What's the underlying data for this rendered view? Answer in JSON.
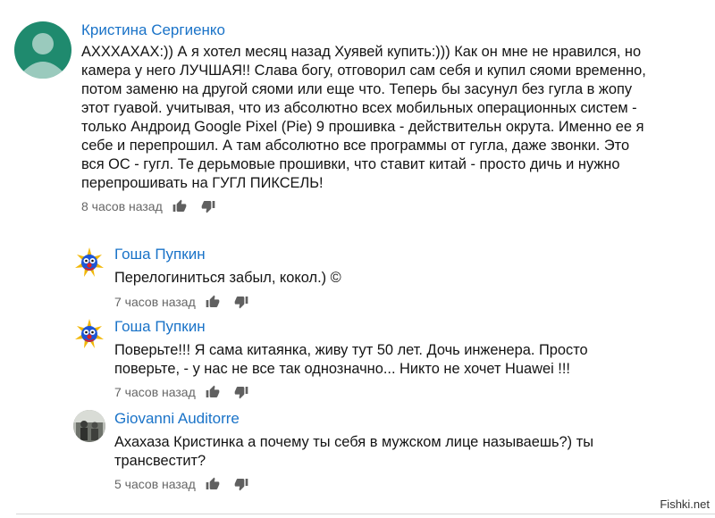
{
  "comments": [
    {
      "author": "Кристина Сергиенко",
      "lines": [
        "АХХХАХАХ:)) А я хотел месяц назад Хуявей купить:))) Как он мне не нравился, но",
        "камера у него ЛУЧШАЯ!! Слава богу, отговорил сам себя и купил сяоми временно,",
        "потом заменю на другой сяоми или еще что. Теперь бы засунул без гугла в жопу",
        "этот гуавой. учитывая, что из абсолютно всех мобильных операционных систем -",
        "только Андроид Google Pixel (Pie) 9 прошивка - действительн окрута. Именно ее я",
        "себе и перепрошил. А там абсолютно все программы от гугла, даже звонки. Это",
        "вся ОС - гугл. Те дерьмовые прошивки, что ставит китай - просто дичь и нужно",
        "перепрошивать на ГУГЛ ПИКСЕЛЬ!"
      ],
      "time": "8 часов назад",
      "avatar_color": "#1f8a6e"
    },
    {
      "author": "Гоша Пупкин",
      "lines": [
        "Перелогиниться забыл, кокол.) ©"
      ],
      "time": "7 часов назад"
    },
    {
      "author": "Гоша Пупкин",
      "lines": [
        "Поверьте!!! Я сама китаянка, живу тут 50 лет. Дочь инженера. Просто",
        "поверьте, - у нас не все так однозначно... Никто не хочет Huawei !!!"
      ],
      "time": "7 часов назад"
    },
    {
      "author": "Giovanni Auditorre",
      "lines": [
        "Ахахаза Кристинка а почему ты себя в мужском лице называешь?) ты",
        "трансвестит?"
      ],
      "time": "5 часов назад"
    }
  ],
  "icons": {
    "like": "thumb-up-icon",
    "dislike": "thumb-down-icon"
  },
  "watermark": "Fishki.net"
}
